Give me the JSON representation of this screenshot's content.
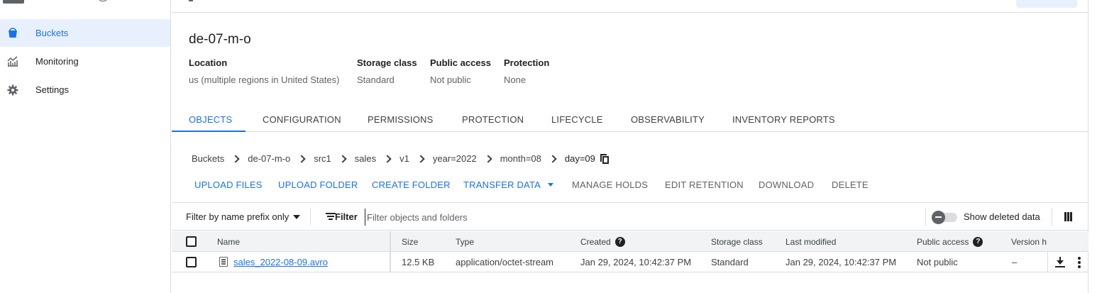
{
  "sidebar": {
    "items": [
      {
        "label": "Buckets",
        "icon": "bucket-icon",
        "active": true
      },
      {
        "label": "Monitoring",
        "icon": "monitoring-chart-icon",
        "active": false
      },
      {
        "label": "Settings",
        "icon": "gear-icon",
        "active": false
      }
    ]
  },
  "bucket": {
    "name": "de-07-m-o",
    "meta": [
      {
        "key": "Location",
        "value": "us (multiple regions in United States)"
      },
      {
        "key": "Storage class",
        "value": "Standard"
      },
      {
        "key": "Public access",
        "value": "Not public"
      },
      {
        "key": "Protection",
        "value": "None"
      }
    ]
  },
  "tabs": [
    "OBJECTS",
    "CONFIGURATION",
    "PERMISSIONS",
    "PROTECTION",
    "LIFECYCLE",
    "OBSERVABILITY",
    "INVENTORY REPORTS"
  ],
  "active_tab": "OBJECTS",
  "breadcrumb": [
    "Buckets",
    "de-07-m-o",
    "src1",
    "sales",
    "v1",
    "year=2022",
    "month=08",
    "day=09"
  ],
  "actions": {
    "upload_files": "UPLOAD FILES",
    "upload_folder": "UPLOAD FOLDER",
    "create_folder": "CREATE FOLDER",
    "transfer_data": "TRANSFER DATA",
    "manage_holds": "MANAGE HOLDS",
    "edit_retention": "EDIT RETENTION",
    "download": "DOWNLOAD",
    "delete": "DELETE"
  },
  "filter": {
    "prefix_label": "Filter by name prefix only",
    "filter_label": "Filter",
    "placeholder": "Filter objects and folders",
    "show_deleted_label": "Show deleted data",
    "show_deleted_on": false
  },
  "table": {
    "headers": {
      "name": "Name",
      "size": "Size",
      "type": "Type",
      "created": "Created",
      "storage_class": "Storage class",
      "last_modified": "Last modified",
      "public_access": "Public access",
      "version": "Version h"
    },
    "rows": [
      {
        "name": "sales_2022-08-09.avro",
        "size": "12.5 KB",
        "type": "application/octet-stream",
        "created": "Jan 29, 2024, 10:42:37 PM",
        "storage_class": "Standard",
        "last_modified": "Jan 29, 2024, 10:42:37 PM",
        "public_access": "Not public",
        "version": "–"
      }
    ]
  },
  "colors": {
    "accent": "#1a73e8",
    "active_bg": "#e8f0fe",
    "border": "#dadce0"
  }
}
